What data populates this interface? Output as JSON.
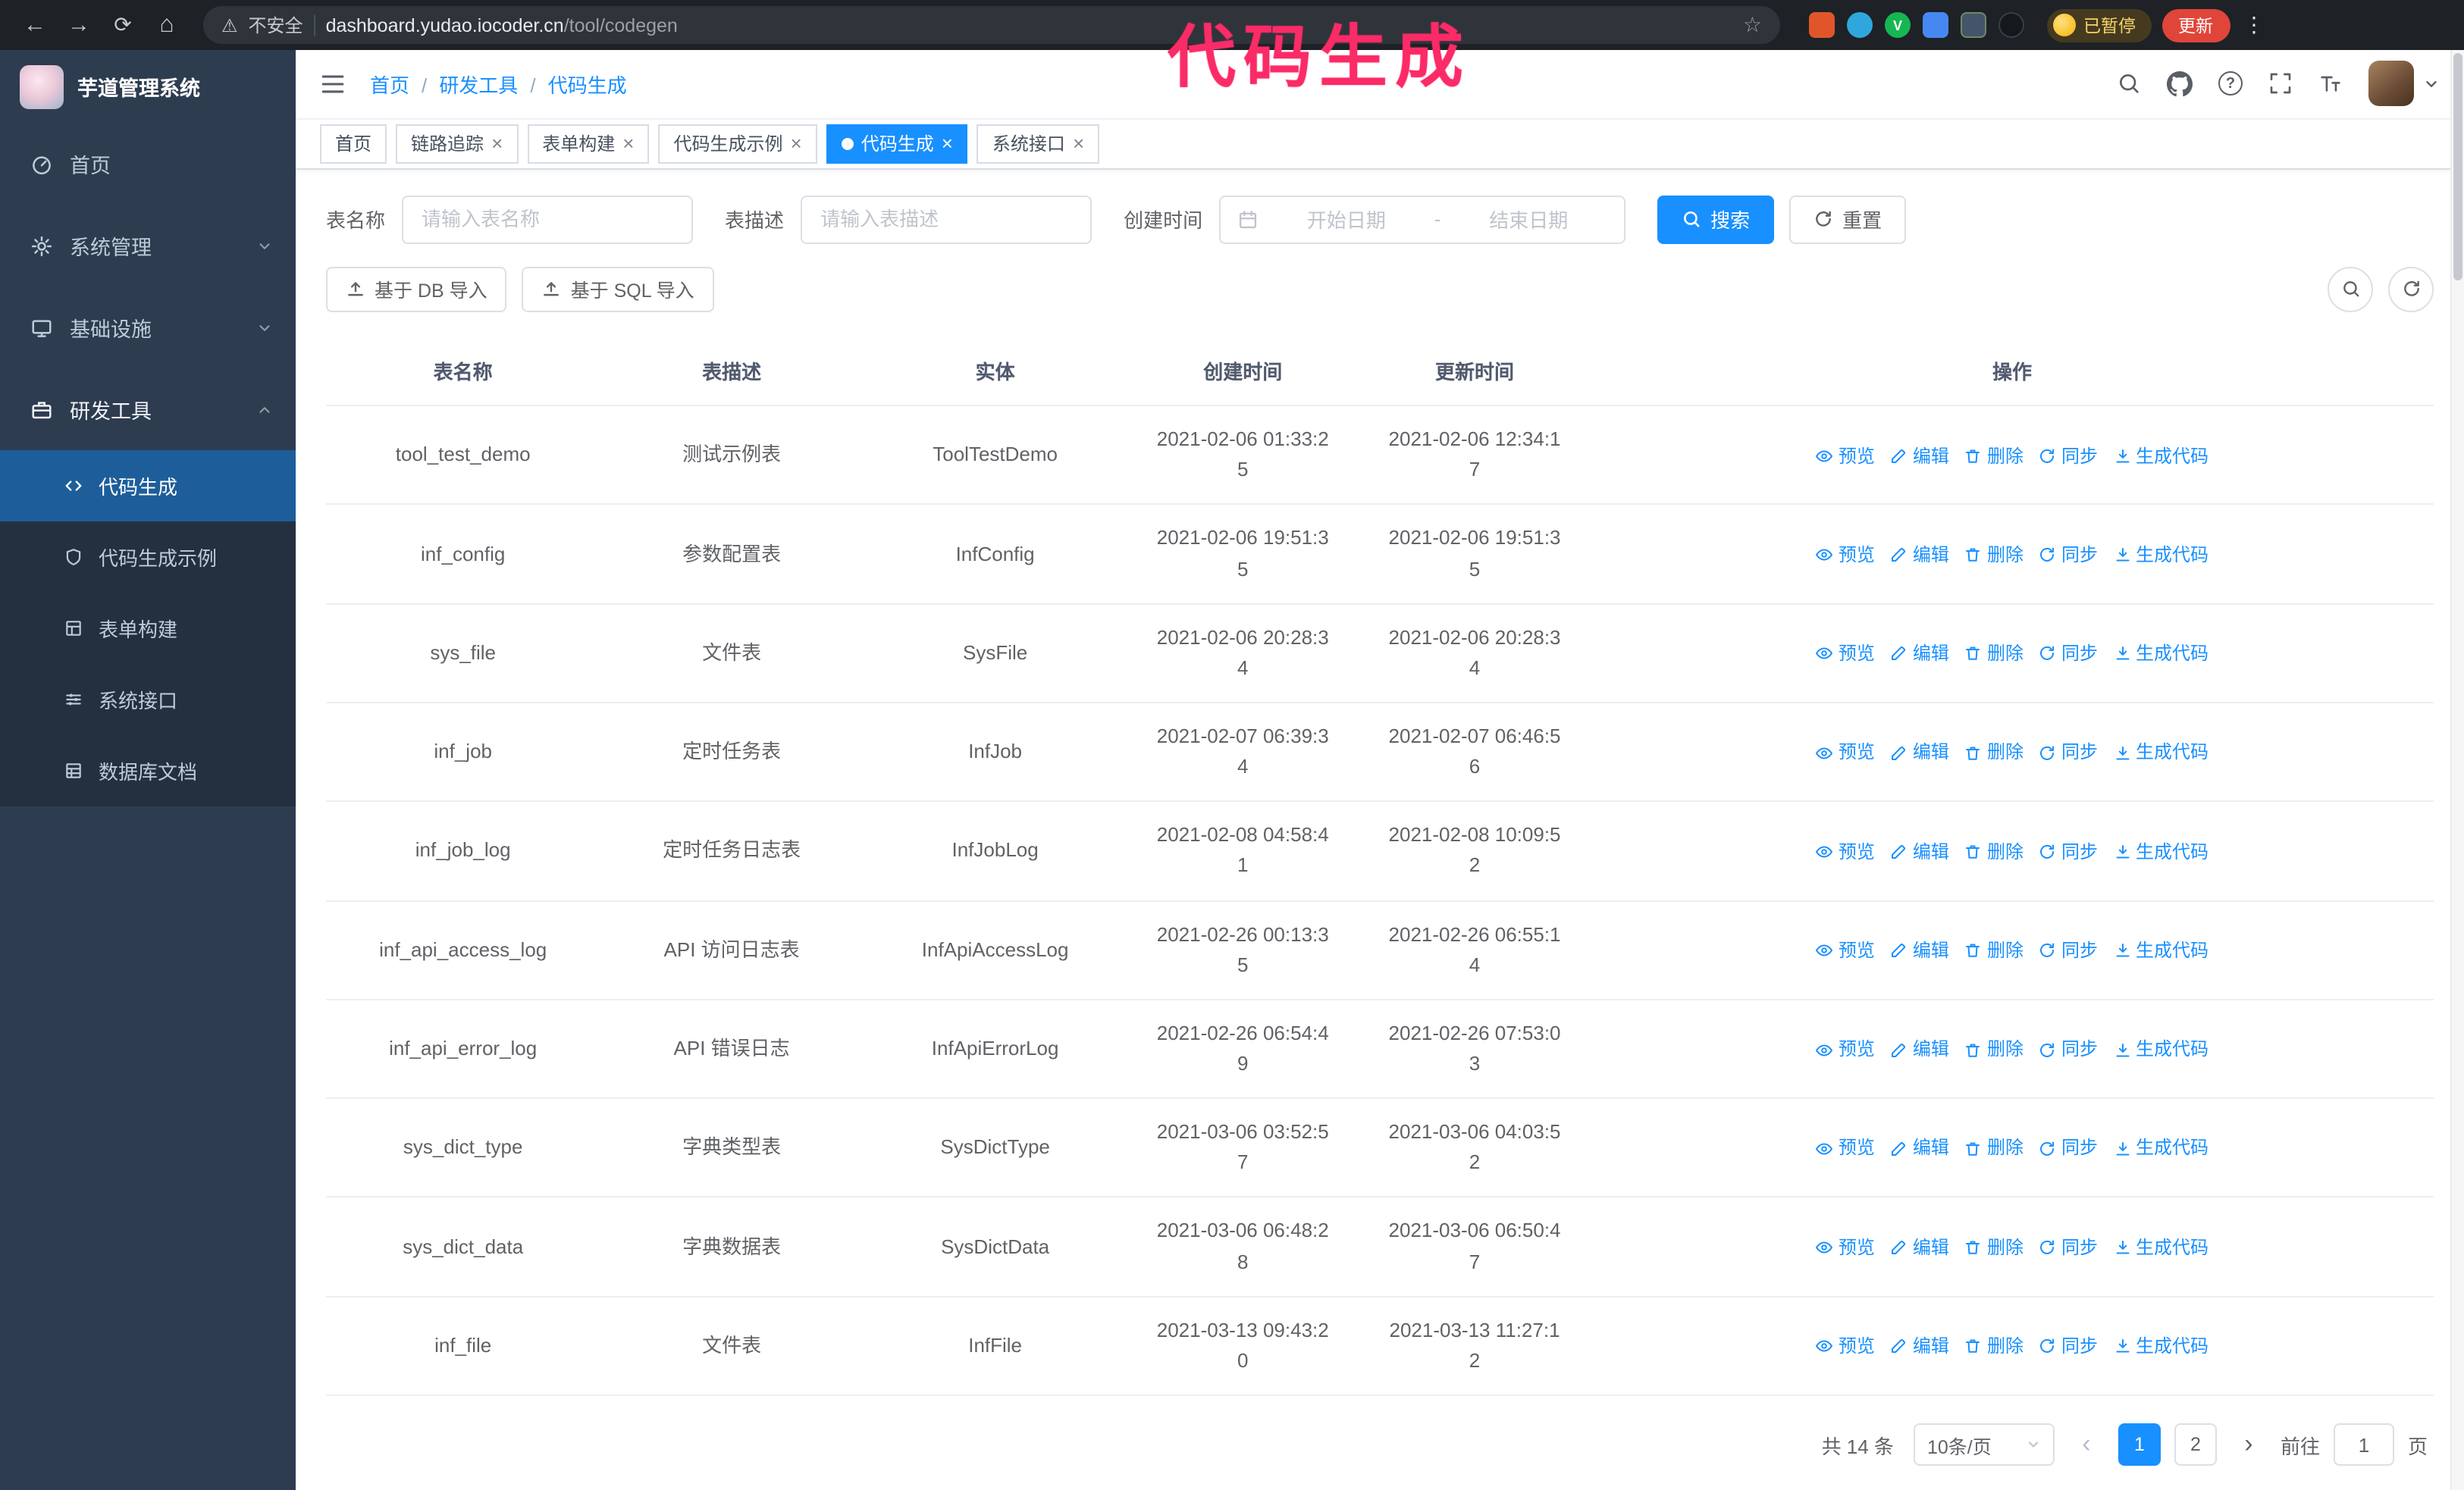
{
  "colors": {
    "primary": "#1890ff",
    "annotation": "#fb2b67",
    "sidebar_bg": "#2e3c50",
    "submenu_bg": "#24303f",
    "update_button_bg": "#e0453a",
    "paused_badge_fg": "#f6d46a"
  },
  "browser": {
    "security_label": "不安全",
    "url_host": "dashboard.yudao.iocoder.cn",
    "url_path": "/tool/codegen",
    "profile_badge": "已暂停",
    "update_label": "更新"
  },
  "annotation": {
    "text": "代码生成"
  },
  "sidebar": {
    "logo_title": "芋道管理系统",
    "items": [
      {
        "label": "首页",
        "icon": "dashboard"
      },
      {
        "label": "系统管理",
        "icon": "gear",
        "chevron": "down"
      },
      {
        "label": "基础设施",
        "icon": "monitor",
        "chevron": "down"
      },
      {
        "label": "研发工具",
        "icon": "toolbox",
        "chevron": "up",
        "open": true
      }
    ],
    "subitems": [
      {
        "label": "代码生成",
        "icon": "code",
        "active": true
      },
      {
        "label": "代码生成示例",
        "icon": "shield"
      },
      {
        "label": "表单构建",
        "icon": "form-grid"
      },
      {
        "label": "系统接口",
        "icon": "sliders"
      },
      {
        "label": "数据库文档",
        "icon": "table-doc"
      }
    ]
  },
  "header": {
    "breadcrumb": [
      "首页",
      "研发工具",
      "代码生成"
    ]
  },
  "tabs": [
    {
      "label": "首页",
      "closable": false
    },
    {
      "label": "链路追踪",
      "closable": true
    },
    {
      "label": "表单构建",
      "closable": true
    },
    {
      "label": "代码生成示例",
      "closable": true
    },
    {
      "label": "代码生成",
      "closable": true,
      "active": true
    },
    {
      "label": "系统接口",
      "closable": true
    }
  ],
  "filters": {
    "table_name_label": "表名称",
    "table_name_placeholder": "请输入表名称",
    "table_desc_label": "表描述",
    "table_desc_placeholder": "请输入表描述",
    "create_time_label": "创建时间",
    "date_start_placeholder": "开始日期",
    "date_separator": "-",
    "date_end_placeholder": "结束日期",
    "search_label": "搜索",
    "reset_label": "重置"
  },
  "toolbar": {
    "import_db_label": "基于 DB 导入",
    "import_sql_label": "基于 SQL 导入"
  },
  "table": {
    "columns": [
      "表名称",
      "表描述",
      "实体",
      "创建时间",
      "更新时间",
      "操作"
    ],
    "actions": [
      {
        "key": "preview",
        "icon": "eye",
        "label": "预览"
      },
      {
        "key": "edit",
        "icon": "edit",
        "label": "编辑"
      },
      {
        "key": "delete",
        "icon": "delete",
        "label": "删除"
      },
      {
        "key": "sync",
        "icon": "sync",
        "label": "同步"
      },
      {
        "key": "generate",
        "icon": "download",
        "label": "生成代码"
      }
    ],
    "rows": [
      {
        "name": "tool_test_demo",
        "desc": "测试示例表",
        "entity": "ToolTestDemo",
        "created": "2021-02-06 01:33:25",
        "updated": "2021-02-06 12:34:17"
      },
      {
        "name": "inf_config",
        "desc": "参数配置表",
        "entity": "InfConfig",
        "created": "2021-02-06 19:51:35",
        "updated": "2021-02-06 19:51:35"
      },
      {
        "name": "sys_file",
        "desc": "文件表",
        "entity": "SysFile",
        "created": "2021-02-06 20:28:34",
        "updated": "2021-02-06 20:28:34"
      },
      {
        "name": "inf_job",
        "desc": "定时任务表",
        "entity": "InfJob",
        "created": "2021-02-07 06:39:34",
        "updated": "2021-02-07 06:46:56"
      },
      {
        "name": "inf_job_log",
        "desc": "定时任务日志表",
        "entity": "InfJobLog",
        "created": "2021-02-08 04:58:41",
        "updated": "2021-02-08 10:09:52"
      },
      {
        "name": "inf_api_access_log",
        "desc": "API 访问日志表",
        "entity": "InfApiAccessLog",
        "created": "2021-02-26 00:13:35",
        "updated": "2021-02-26 06:55:14"
      },
      {
        "name": "inf_api_error_log",
        "desc": "API 错误日志",
        "entity": "InfApiErrorLog",
        "created": "2021-02-26 06:54:49",
        "updated": "2021-02-26 07:53:03"
      },
      {
        "name": "sys_dict_type",
        "desc": "字典类型表",
        "entity": "SysDictType",
        "created": "2021-03-06 03:52:57",
        "updated": "2021-03-06 04:03:52"
      },
      {
        "name": "sys_dict_data",
        "desc": "字典数据表",
        "entity": "SysDictData",
        "created": "2021-03-06 06:48:28",
        "updated": "2021-03-06 06:50:47"
      },
      {
        "name": "inf_file",
        "desc": "文件表",
        "entity": "InfFile",
        "created": "2021-03-13 09:43:20",
        "updated": "2021-03-13 11:27:12"
      }
    ]
  },
  "pagination": {
    "total": "共 14 条",
    "page_size": "10条/页",
    "pages": [
      "1",
      "2"
    ],
    "active_page": "1",
    "goto_label": "前往",
    "goto_value": "1",
    "goto_suffix": "页"
  }
}
